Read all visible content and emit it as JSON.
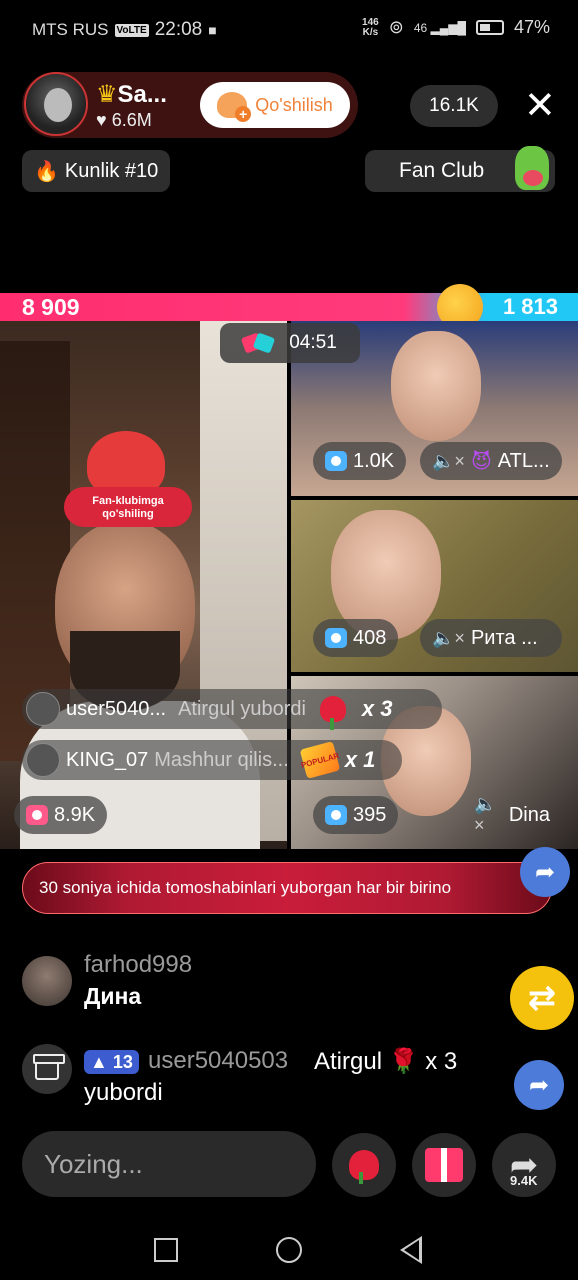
{
  "status_bar": {
    "carrier": "MTS RUS",
    "volte": "VoLTE",
    "time": "22:08",
    "speed_value": "146",
    "speed_unit": "K/s",
    "network": "46",
    "battery": "47%"
  },
  "host": {
    "name": "Sa...",
    "likes": "6.6M",
    "follow_label": "Qo'shilish",
    "crown_icon": "crown-icon"
  },
  "viewers": "16.1K",
  "daily_rank": "Kunlik #10",
  "fan_club": "Fan Club",
  "battle": {
    "score_left": "8 909",
    "score_right": "1 813",
    "timer": "04:51",
    "colors": {
      "left": "#ff2d6f",
      "right": "#21c7f5"
    }
  },
  "main_video": {
    "sticker_text": "Fan-klubimga qo'shiling",
    "count": "8.9K"
  },
  "guests": [
    {
      "count": "1.0K",
      "name": "ATL..."
    },
    {
      "count": "408",
      "name": "Рита ..."
    },
    {
      "count": "395",
      "name": "Dina"
    }
  ],
  "gift_feed": [
    {
      "user": "user5040...",
      "message": "Atirgul  yubordi",
      "multiplier": "x 3"
    },
    {
      "user": "KING_07",
      "message": "Mashhur qilis...",
      "multiplier": "x 1",
      "badge": "POPULAR"
    }
  ],
  "banner": {
    "text": "30 soniya ichida tomoshabinlari yuborgan har bir birino"
  },
  "comments": [
    {
      "user": "farhod998",
      "text": "Дина"
    }
  ],
  "gift_comment": {
    "level": "13",
    "user": "user5040503",
    "text_1": "Atirgul",
    "multiplier": "x 3",
    "text_2": "yubordi"
  },
  "input": {
    "placeholder": "Yozing..."
  },
  "share_count": "9.4K"
}
